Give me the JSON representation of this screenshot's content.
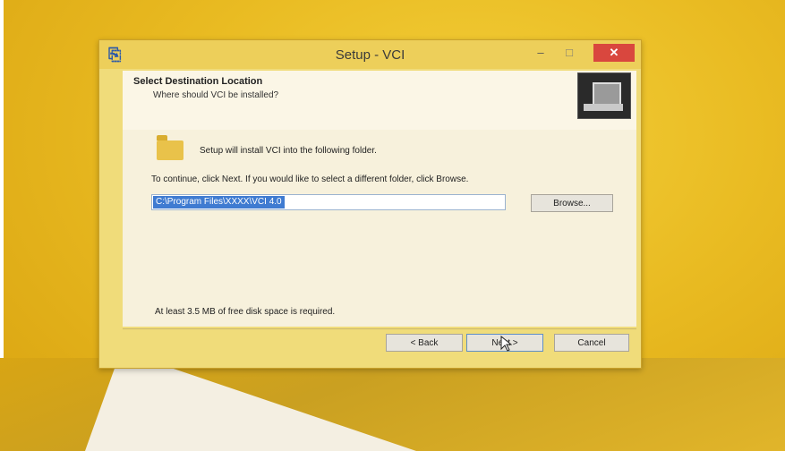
{
  "window": {
    "title": "Setup - VCI",
    "minimize_glyph": "–",
    "maximize_glyph": "□",
    "close_glyph": "✕"
  },
  "header": {
    "title": "Select Destination Location",
    "subtitle": "Where should VCI be installed?"
  },
  "body": {
    "install_text": "Setup will install VCI into the following folder.",
    "continue_text": "To continue, click Next. If you would like to select a different folder, click Browse.",
    "path_value": "C:\\Program Files\\XXXX\\VCI 4.0",
    "browse_label": "Browse...",
    "disk_space_text": "At least 3.5 MB of free disk space is required."
  },
  "footer": {
    "back_label": "< Back",
    "next_label": "Next >",
    "cancel_label": "Cancel"
  },
  "icons": {
    "app": "setup-app-icon",
    "folder": "folder-icon",
    "header_graphic": "install-computer-icon",
    "cursor": "mouse-pointer-icon"
  },
  "colors": {
    "desktop": "#e8b820",
    "close_button": "#d9473e",
    "selection": "#3f7bd1"
  }
}
